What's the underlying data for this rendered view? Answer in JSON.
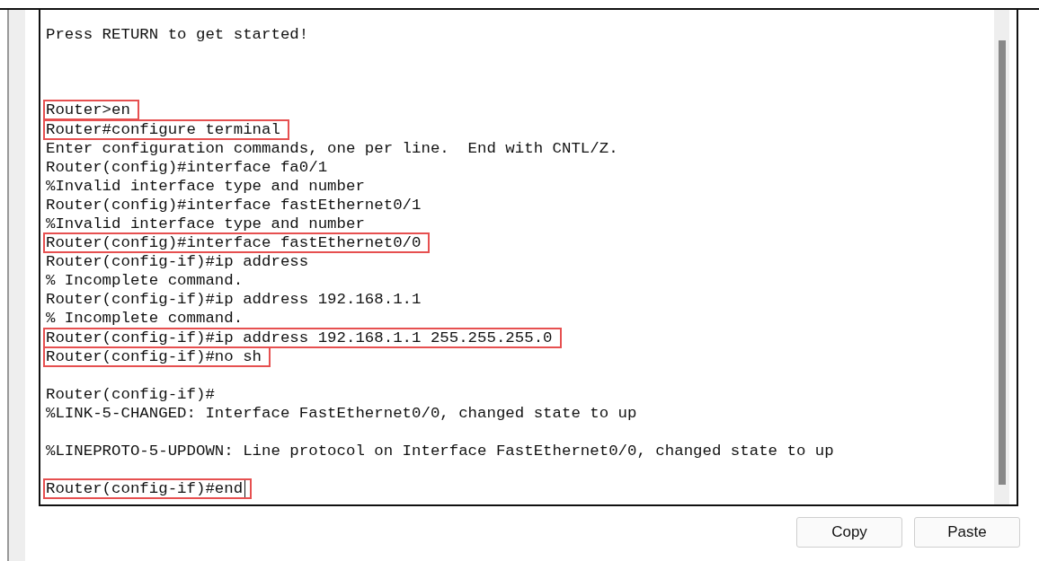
{
  "terminal": {
    "lines": [
      {
        "kind": "text",
        "text": "Press RETURN to get started!",
        "highlighted": false,
        "cursor": false
      },
      {
        "kind": "blank"
      },
      {
        "kind": "blank"
      },
      {
        "kind": "blank"
      },
      {
        "kind": "text",
        "text": "Router>en",
        "highlighted": true,
        "cursor": false
      },
      {
        "kind": "text",
        "text": "Router#configure terminal",
        "highlighted": true,
        "cursor": false
      },
      {
        "kind": "text",
        "text": "Enter configuration commands, one per line.  End with CNTL/Z.",
        "highlighted": false,
        "cursor": false
      },
      {
        "kind": "text",
        "text": "Router(config)#interface fa0/1",
        "highlighted": false,
        "cursor": false
      },
      {
        "kind": "text",
        "text": "%Invalid interface type and number",
        "highlighted": false,
        "cursor": false
      },
      {
        "kind": "text",
        "text": "Router(config)#interface fastEthernet0/1",
        "highlighted": false,
        "cursor": false
      },
      {
        "kind": "text",
        "text": "%Invalid interface type and number",
        "highlighted": false,
        "cursor": false
      },
      {
        "kind": "text",
        "text": "Router(config)#interface fastEthernet0/0",
        "highlighted": true,
        "cursor": false
      },
      {
        "kind": "text",
        "text": "Router(config-if)#ip address",
        "highlighted": false,
        "cursor": false
      },
      {
        "kind": "text",
        "text": "% Incomplete command.",
        "highlighted": false,
        "cursor": false
      },
      {
        "kind": "text",
        "text": "Router(config-if)#ip address 192.168.1.1",
        "highlighted": false,
        "cursor": false
      },
      {
        "kind": "text",
        "text": "% Incomplete command.",
        "highlighted": false,
        "cursor": false
      },
      {
        "kind": "text",
        "text": "Router(config-if)#ip address 192.168.1.1 255.255.255.0",
        "highlighted": true,
        "cursor": false
      },
      {
        "kind": "text",
        "text": "Router(config-if)#no sh",
        "highlighted": true,
        "cursor": false
      },
      {
        "kind": "blank"
      },
      {
        "kind": "text",
        "text": "Router(config-if)#",
        "highlighted": false,
        "cursor": false
      },
      {
        "kind": "text",
        "text": "%LINK-5-CHANGED: Interface FastEthernet0/0, changed state to up",
        "highlighted": false,
        "cursor": false
      },
      {
        "kind": "blank"
      },
      {
        "kind": "text",
        "text": "%LINEPROTO-5-UPDOWN: Line protocol on Interface FastEthernet0/0, changed state to up",
        "highlighted": false,
        "cursor": false
      },
      {
        "kind": "blank"
      },
      {
        "kind": "text",
        "text": "Router(config-if)#end",
        "highlighted": true,
        "cursor": true
      }
    ]
  },
  "buttons": [
    {
      "label": "Copy"
    },
    {
      "label": "Paste"
    }
  ]
}
